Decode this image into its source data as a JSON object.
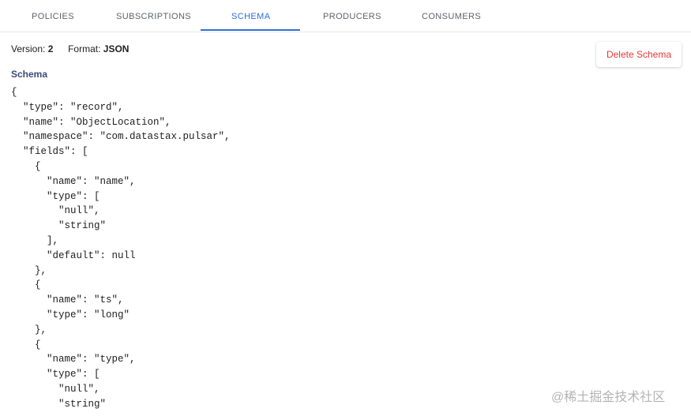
{
  "tabs": [
    {
      "label": "POLICIES",
      "active": false
    },
    {
      "label": "SUBSCRIPTIONS",
      "active": false
    },
    {
      "label": "SCHEMA",
      "active": true
    },
    {
      "label": "PRODUCERS",
      "active": false
    },
    {
      "label": "CONSUMERS",
      "active": false
    }
  ],
  "meta": {
    "version_label": "Version:",
    "version_value": "2",
    "format_label": "Format:",
    "format_value": "JSON"
  },
  "actions": {
    "delete_label": "Delete Schema"
  },
  "schema": {
    "section_label": "Schema",
    "code": "{\n  \"type\": \"record\",\n  \"name\": \"ObjectLocation\",\n  \"namespace\": \"com.datastax.pulsar\",\n  \"fields\": [\n    {\n      \"name\": \"name\",\n      \"type\": [\n        \"null\",\n        \"string\"\n      ],\n      \"default\": null\n    },\n    {\n      \"name\": \"ts\",\n      \"type\": \"long\"\n    },\n    {\n      \"name\": \"type\",\n      \"type\": [\n        \"null\",\n        \"string\""
  },
  "watermark": "@稀土掘金技术社区",
  "colors": {
    "accent": "#2f6fd6",
    "danger": "#e53935",
    "heading": "#3d4a7a"
  }
}
